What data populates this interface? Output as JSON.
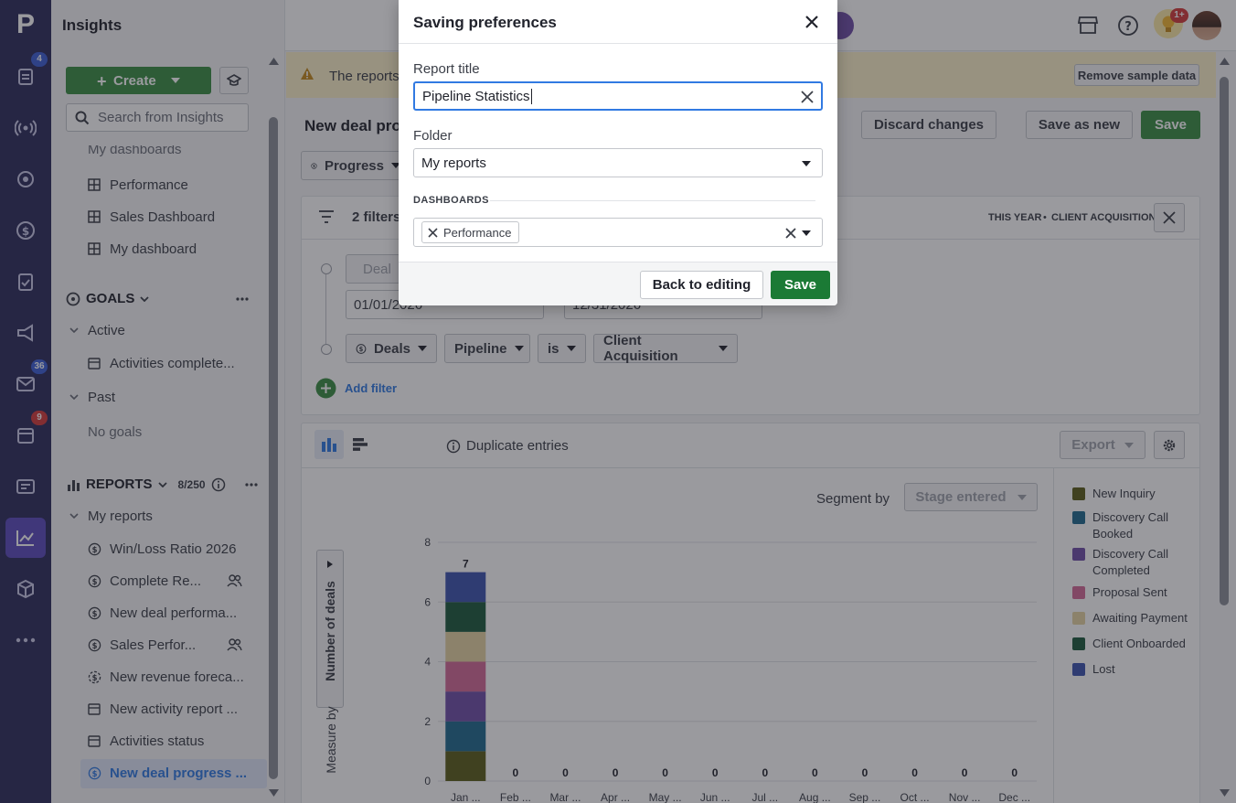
{
  "app": {
    "section_title": "Insights",
    "logo": "P"
  },
  "rail": {
    "badges": {
      "deals": "4",
      "mail": "36",
      "calendar": "9"
    },
    "icons": [
      "deals-icon",
      "radio-icon",
      "target-icon",
      "dollar-icon",
      "clipboard-icon",
      "megaphone-icon",
      "mail-icon",
      "calendar-icon",
      "contact-card-icon",
      "insights-chart-icon",
      "box-icon",
      "more-icon"
    ]
  },
  "header": {
    "notification_badge": "1+"
  },
  "sidebar": {
    "create_label": "Create",
    "search_placeholder": "Search from Insights",
    "dashboards_partial": "My dashboards",
    "dashboards": [
      "Performance",
      "Sales Dashboard",
      "My dashboard"
    ],
    "goals_title": "GOALS",
    "goals_active": "Active",
    "goals_active_items": [
      "Activities complete..."
    ],
    "goals_past": "Past",
    "goals_none": "No goals",
    "reports_title": "REPORTS",
    "reports_count": "8/250",
    "my_reports": "My reports",
    "reports": [
      "Win/Loss Ratio 2026",
      "Complete Re...",
      "New deal performa...",
      "Sales Perfor...",
      "New revenue foreca...",
      "New activity report ...",
      "Activities status",
      "New deal progress ..."
    ]
  },
  "main": {
    "banner_text": "The reports",
    "remove_sample": "Remove sample data",
    "title": "New deal prog",
    "discard": "Discard changes",
    "save_as_new": "Save as new",
    "save": "Save",
    "progress_chip": "Progress",
    "filters_count": "2 filters",
    "period": "THIS YEAR",
    "pipeline_tag": "CLIENT ACQUISITION",
    "filter_deals_dis": "Deal",
    "date_from": "01/01/2026",
    "date_to": "12/31/2026",
    "filter_deals": "Deals",
    "filter_pipeline": "Pipeline",
    "filter_is": "is",
    "filter_value": "Client Acquisition",
    "add_filter": "Add filter",
    "duplicate": "Duplicate entries",
    "export": "Export",
    "segment_by": "Segment by",
    "segment_value": "Stage entered",
    "measure_by": "Measure by",
    "measure_value": "Number of deals"
  },
  "chart_data": {
    "type": "bar",
    "categories": [
      "Jan ...",
      "Feb ...",
      "Mar ...",
      "Apr ...",
      "May ...",
      "Jun ...",
      "Jul ...",
      "Aug ...",
      "Sep ...",
      "Oct ...",
      "Nov ...",
      "Dec ..."
    ],
    "totals": [
      7,
      0,
      0,
      0,
      0,
      0,
      0,
      0,
      0,
      0,
      0,
      0
    ],
    "series": [
      {
        "name": "New Inquiry",
        "color": "#5c5d1a",
        "values": [
          1,
          0,
          0,
          0,
          0,
          0,
          0,
          0,
          0,
          0,
          0,
          0
        ]
      },
      {
        "name": "Discovery Call Booked",
        "color": "#1f6b8f",
        "values": [
          1,
          0,
          0,
          0,
          0,
          0,
          0,
          0,
          0,
          0,
          0,
          0
        ]
      },
      {
        "name": "Discovery Call Completed",
        "color": "#6f4fa8",
        "values": [
          1,
          0,
          0,
          0,
          0,
          0,
          0,
          0,
          0,
          0,
          0,
          0
        ]
      },
      {
        "name": "Proposal Sent",
        "color": "#d46a97",
        "values": [
          1,
          0,
          0,
          0,
          0,
          0,
          0,
          0,
          0,
          0,
          0,
          0
        ]
      },
      {
        "name": "Awaiting Payment",
        "color": "#e6d3a3",
        "values": [
          1,
          0,
          0,
          0,
          0,
          0,
          0,
          0,
          0,
          0,
          0,
          0
        ]
      },
      {
        "name": "Client Onboarded",
        "color": "#1d5a3c",
        "values": [
          1,
          0,
          0,
          0,
          0,
          0,
          0,
          0,
          0,
          0,
          0,
          0
        ]
      },
      {
        "name": "Lost",
        "color": "#3c55b0",
        "values": [
          1,
          0,
          0,
          0,
          0,
          0,
          0,
          0,
          0,
          0,
          0,
          0
        ]
      }
    ],
    "yticks": [
      0,
      2,
      4,
      6,
      8
    ],
    "ylim": [
      0,
      8
    ],
    "ylabel": "Number of deals",
    "grid": true,
    "legend": "right"
  },
  "modal": {
    "title": "Saving preferences",
    "report_title_label": "Report title",
    "report_title_value": "Pipeline Statistics",
    "folder_label": "Folder",
    "folder_value": "My reports",
    "dashboards_label": "DASHBOARDS",
    "dashboard_tag": "Performance",
    "back_button": "Back to editing",
    "save_button": "Save"
  },
  "colors": {
    "accent_green": "#3b8e44",
    "modal_save_green": "#1b7a35",
    "rail_bg": "#2d2c5c",
    "focus_blue": "#317ae2"
  }
}
